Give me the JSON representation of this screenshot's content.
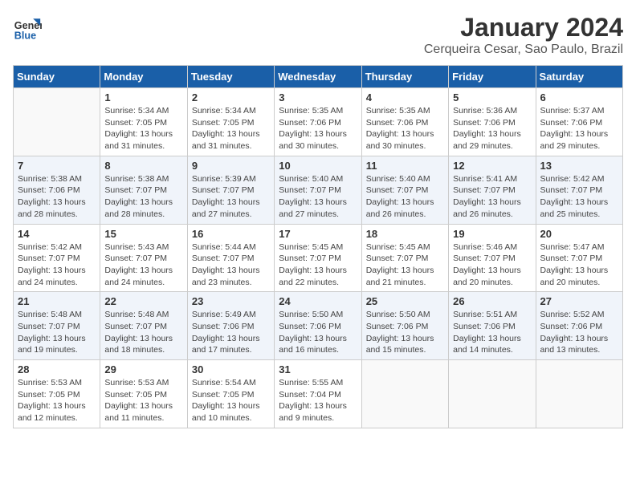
{
  "header": {
    "logo_line1": "General",
    "logo_line2": "Blue",
    "title": "January 2024",
    "subtitle": "Cerqueira Cesar, Sao Paulo, Brazil"
  },
  "weekdays": [
    "Sunday",
    "Monday",
    "Tuesday",
    "Wednesday",
    "Thursday",
    "Friday",
    "Saturday"
  ],
  "weeks": [
    [
      {
        "day": "",
        "info": ""
      },
      {
        "day": "1",
        "info": "Sunrise: 5:34 AM\nSunset: 7:05 PM\nDaylight: 13 hours\nand 31 minutes."
      },
      {
        "day": "2",
        "info": "Sunrise: 5:34 AM\nSunset: 7:05 PM\nDaylight: 13 hours\nand 31 minutes."
      },
      {
        "day": "3",
        "info": "Sunrise: 5:35 AM\nSunset: 7:06 PM\nDaylight: 13 hours\nand 30 minutes."
      },
      {
        "day": "4",
        "info": "Sunrise: 5:35 AM\nSunset: 7:06 PM\nDaylight: 13 hours\nand 30 minutes."
      },
      {
        "day": "5",
        "info": "Sunrise: 5:36 AM\nSunset: 7:06 PM\nDaylight: 13 hours\nand 29 minutes."
      },
      {
        "day": "6",
        "info": "Sunrise: 5:37 AM\nSunset: 7:06 PM\nDaylight: 13 hours\nand 29 minutes."
      }
    ],
    [
      {
        "day": "7",
        "info": "Sunrise: 5:38 AM\nSunset: 7:06 PM\nDaylight: 13 hours\nand 28 minutes."
      },
      {
        "day": "8",
        "info": "Sunrise: 5:38 AM\nSunset: 7:07 PM\nDaylight: 13 hours\nand 28 minutes."
      },
      {
        "day": "9",
        "info": "Sunrise: 5:39 AM\nSunset: 7:07 PM\nDaylight: 13 hours\nand 27 minutes."
      },
      {
        "day": "10",
        "info": "Sunrise: 5:40 AM\nSunset: 7:07 PM\nDaylight: 13 hours\nand 27 minutes."
      },
      {
        "day": "11",
        "info": "Sunrise: 5:40 AM\nSunset: 7:07 PM\nDaylight: 13 hours\nand 26 minutes."
      },
      {
        "day": "12",
        "info": "Sunrise: 5:41 AM\nSunset: 7:07 PM\nDaylight: 13 hours\nand 26 minutes."
      },
      {
        "day": "13",
        "info": "Sunrise: 5:42 AM\nSunset: 7:07 PM\nDaylight: 13 hours\nand 25 minutes."
      }
    ],
    [
      {
        "day": "14",
        "info": "Sunrise: 5:42 AM\nSunset: 7:07 PM\nDaylight: 13 hours\nand 24 minutes."
      },
      {
        "day": "15",
        "info": "Sunrise: 5:43 AM\nSunset: 7:07 PM\nDaylight: 13 hours\nand 24 minutes."
      },
      {
        "day": "16",
        "info": "Sunrise: 5:44 AM\nSunset: 7:07 PM\nDaylight: 13 hours\nand 23 minutes."
      },
      {
        "day": "17",
        "info": "Sunrise: 5:45 AM\nSunset: 7:07 PM\nDaylight: 13 hours\nand 22 minutes."
      },
      {
        "day": "18",
        "info": "Sunrise: 5:45 AM\nSunset: 7:07 PM\nDaylight: 13 hours\nand 21 minutes."
      },
      {
        "day": "19",
        "info": "Sunrise: 5:46 AM\nSunset: 7:07 PM\nDaylight: 13 hours\nand 20 minutes."
      },
      {
        "day": "20",
        "info": "Sunrise: 5:47 AM\nSunset: 7:07 PM\nDaylight: 13 hours\nand 20 minutes."
      }
    ],
    [
      {
        "day": "21",
        "info": "Sunrise: 5:48 AM\nSunset: 7:07 PM\nDaylight: 13 hours\nand 19 minutes."
      },
      {
        "day": "22",
        "info": "Sunrise: 5:48 AM\nSunset: 7:07 PM\nDaylight: 13 hours\nand 18 minutes."
      },
      {
        "day": "23",
        "info": "Sunrise: 5:49 AM\nSunset: 7:06 PM\nDaylight: 13 hours\nand 17 minutes."
      },
      {
        "day": "24",
        "info": "Sunrise: 5:50 AM\nSunset: 7:06 PM\nDaylight: 13 hours\nand 16 minutes."
      },
      {
        "day": "25",
        "info": "Sunrise: 5:50 AM\nSunset: 7:06 PM\nDaylight: 13 hours\nand 15 minutes."
      },
      {
        "day": "26",
        "info": "Sunrise: 5:51 AM\nSunset: 7:06 PM\nDaylight: 13 hours\nand 14 minutes."
      },
      {
        "day": "27",
        "info": "Sunrise: 5:52 AM\nSunset: 7:06 PM\nDaylight: 13 hours\nand 13 minutes."
      }
    ],
    [
      {
        "day": "28",
        "info": "Sunrise: 5:53 AM\nSunset: 7:05 PM\nDaylight: 13 hours\nand 12 minutes."
      },
      {
        "day": "29",
        "info": "Sunrise: 5:53 AM\nSunset: 7:05 PM\nDaylight: 13 hours\nand 11 minutes."
      },
      {
        "day": "30",
        "info": "Sunrise: 5:54 AM\nSunset: 7:05 PM\nDaylight: 13 hours\nand 10 minutes."
      },
      {
        "day": "31",
        "info": "Sunrise: 5:55 AM\nSunset: 7:04 PM\nDaylight: 13 hours\nand 9 minutes."
      },
      {
        "day": "",
        "info": ""
      },
      {
        "day": "",
        "info": ""
      },
      {
        "day": "",
        "info": ""
      }
    ]
  ]
}
